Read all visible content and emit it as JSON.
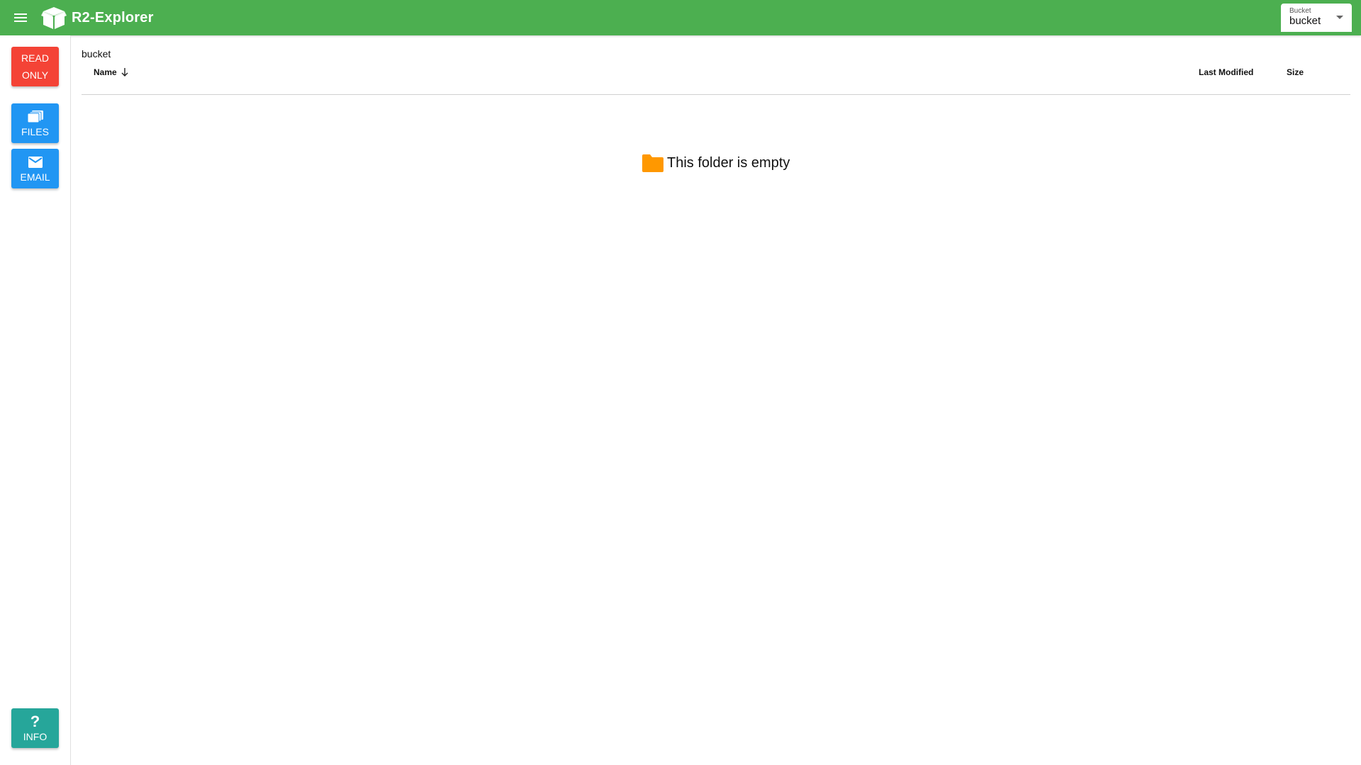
{
  "app": {
    "title": "R2-Explorer",
    "brand_color": "#4caf50"
  },
  "topbar": {
    "menu_icon": "menu-icon",
    "logo_icon": "open-box-icon",
    "bucket_select": {
      "label": "Bucket",
      "value": "bucket"
    }
  },
  "sidebar": {
    "read_only": {
      "line1": "READ",
      "line2": "ONLY",
      "color": "#f44336"
    },
    "files": {
      "label": "FILES",
      "icon": "folders-icon",
      "color": "#2196f3"
    },
    "email": {
      "label": "EMAIL",
      "icon": "mail-icon",
      "color": "#2196f3"
    },
    "info": {
      "label": "INFO",
      "icon": "question-icon",
      "glyph": "?",
      "color": "#26a69a"
    }
  },
  "main": {
    "breadcrumb": "bucket",
    "columns": {
      "name": "Name",
      "last_modified": "Last Modified",
      "size": "Size"
    },
    "sort_icon": "arrow-down-icon",
    "empty_state": {
      "icon": "folder-icon",
      "icon_color": "#ff9800",
      "text": "This folder is empty"
    }
  }
}
